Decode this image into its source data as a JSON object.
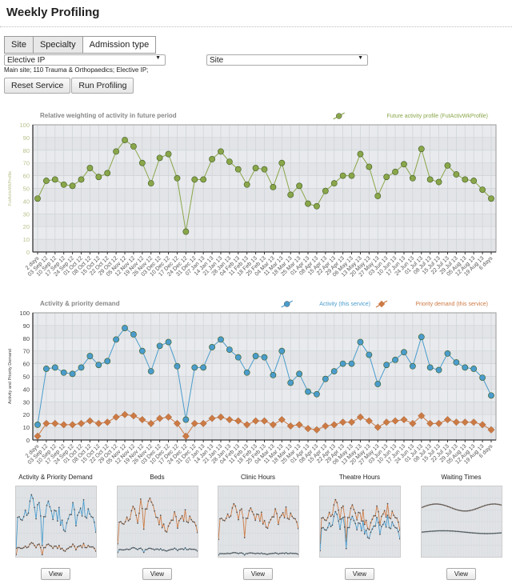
{
  "header": {
    "title": "Weekly Profiling"
  },
  "tabs": [
    {
      "label": "Site"
    },
    {
      "label": "Specialty"
    },
    {
      "label": "Admission type"
    }
  ],
  "filters": {
    "admission_type_value": "Elective IP",
    "site_value": "Site",
    "breadcrumb": "Main site; 110 Trauma & Orthopaedics; Elective IP;"
  },
  "actions": {
    "reset_label": "Reset Service",
    "run_label": "Run Profiling"
  },
  "colors": {
    "green": "#8aa64a",
    "blue": "#4a9ccc",
    "orange": "#cc7a44"
  },
  "chart_data": [
    {
      "type": "line",
      "title": "Relative weighting of activity in future period",
      "xlabel": "",
      "ylabel": "FutActivWkProfile",
      "ylim": [
        0,
        100
      ],
      "yticks": [
        0,
        10,
        20,
        30,
        40,
        50,
        60,
        70,
        80,
        90,
        100
      ],
      "grid": true,
      "legend": "top-right",
      "categories": [
        "2 days",
        "03 Sep 12",
        "10 Sep 12",
        "17 Sep 12",
        "24 Sep 12",
        "01 Oct 12",
        "08 Oct 12",
        "15 Oct 12",
        "22 Oct 12",
        "29 Oct 12",
        "05 Nov 12",
        "12 Nov 12",
        "19 Nov 12",
        "26 Nov 12",
        "03 Dec 12",
        "10 Dec 12",
        "17 Dec 12",
        "24 Dec 12",
        "31 Dec 12",
        "07 Jan 13",
        "14 Jan 13",
        "21 Jan 13",
        "28 Jan 13",
        "04 Feb 13",
        "11 Feb 13",
        "18 Feb 13",
        "25 Feb 13",
        "04 Mar 13",
        "11 Mar 13",
        "18 Mar 13",
        "25 Mar 13",
        "01 Apr 13",
        "08 Apr 13",
        "15 Apr 13",
        "22 Apr 13",
        "29 Apr 13",
        "06 May 13",
        "13 May 13",
        "20 May 13",
        "27 May 13",
        "03 Jun 13",
        "10 Jun 13",
        "17 Jun 13",
        "24 Jun 13",
        "01 Jul 13",
        "08 Jul 13",
        "15 Jul 13",
        "22 Jul 13",
        "29 Jul 13",
        "05 Aug 13",
        "12 Aug 13",
        "19 Aug 13",
        "6 days"
      ],
      "series": [
        {
          "name": "Future activity profile (FutActivWkProfile)",
          "color": "#8aa64a",
          "marker": "circle",
          "values": [
            42,
            56,
            57,
            53,
            52,
            57,
            66,
            59,
            62,
            79,
            88,
            83,
            70,
            54,
            74,
            77,
            58,
            16,
            57,
            57,
            73,
            79,
            71,
            65,
            53,
            66,
            65,
            51,
            70,
            45,
            52,
            38,
            36,
            48,
            54,
            60,
            60,
            77,
            67,
            44,
            59,
            63,
            69,
            58,
            81,
            57,
            55,
            68,
            61,
            57,
            56,
            49,
            42
          ]
        }
      ]
    },
    {
      "type": "line",
      "title": "Activity & priority demand",
      "xlabel": "",
      "ylabel": "Activity and Priority Demand",
      "ylim": [
        0,
        100
      ],
      "yticks": [
        0,
        10,
        20,
        30,
        40,
        50,
        60,
        70,
        80,
        90,
        100
      ],
      "grid": true,
      "legend": "top-right",
      "categories": [
        "2 days",
        "03 Sep 12",
        "10 Sep 12",
        "17 Sep 12",
        "24 Sep 12",
        "01 Oct 12",
        "08 Oct 12",
        "15 Oct 12",
        "22 Oct 12",
        "29 Oct 12",
        "05 Nov 12",
        "12 Nov 12",
        "19 Nov 12",
        "26 Nov 12",
        "03 Dec 12",
        "10 Dec 12",
        "17 Dec 12",
        "24 Dec 12",
        "31 Dec 12",
        "07 Jan 13",
        "14 Jan 13",
        "21 Jan 13",
        "28 Jan 13",
        "04 Feb 13",
        "11 Feb 13",
        "18 Feb 13",
        "25 Feb 13",
        "04 Mar 13",
        "11 Mar 13",
        "18 Mar 13",
        "25 Mar 13",
        "01 Apr 13",
        "08 Apr 13",
        "15 Apr 13",
        "22 Apr 13",
        "29 Apr 13",
        "06 May 13",
        "13 May 13",
        "20 May 13",
        "27 May 13",
        "03 Jun 13",
        "10 Jun 13",
        "17 Jun 13",
        "24 Jun 13",
        "01 Jul 13",
        "08 Jul 13",
        "15 Jul 13",
        "22 Jul 13",
        "29 Jul 13",
        "05 Aug 13",
        "12 Aug 13",
        "19 Aug 13",
        "6 days"
      ],
      "series": [
        {
          "name": "Activity (this service)",
          "color": "#4a9ccc",
          "marker": "circle",
          "values": [
            12,
            56,
            57,
            53,
            52,
            57,
            66,
            59,
            62,
            79,
            88,
            83,
            70,
            54,
            74,
            77,
            58,
            16,
            57,
            57,
            73,
            79,
            71,
            65,
            53,
            66,
            65,
            51,
            70,
            45,
            52,
            38,
            36,
            48,
            54,
            60,
            60,
            77,
            67,
            44,
            59,
            63,
            69,
            58,
            81,
            57,
            55,
            68,
            61,
            57,
            56,
            49,
            35
          ]
        },
        {
          "name": "Priority demand (this service)",
          "color": "#cc7a44",
          "marker": "diamond",
          "values": [
            3,
            13,
            13,
            12,
            12,
            13,
            15,
            13,
            14,
            18,
            20,
            19,
            16,
            13,
            17,
            18,
            13,
            3,
            13,
            13,
            17,
            18,
            16,
            15,
            12,
            15,
            15,
            12,
            16,
            11,
            12,
            9,
            8,
            11,
            12,
            14,
            14,
            18,
            15,
            10,
            14,
            15,
            16,
            13,
            19,
            13,
            13,
            16,
            14,
            14,
            14,
            12,
            8
          ]
        }
      ]
    }
  ],
  "thumbnails": [
    {
      "title": "Activity & Priority Demand",
      "view_label": "View"
    },
    {
      "title": "Beds",
      "view_label": "View"
    },
    {
      "title": "Clinic Hours",
      "view_label": "View"
    },
    {
      "title": "Theatre Hours",
      "view_label": "View"
    },
    {
      "title": "Waiting Times",
      "view_label": "View"
    }
  ]
}
